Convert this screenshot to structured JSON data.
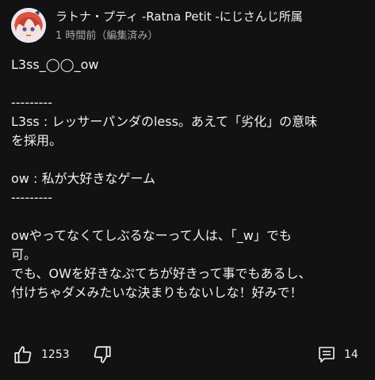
{
  "post": {
    "author": "ラトナ・プティ -Ratna Petit -にじさんじ所属",
    "timestamp": "1 時間前（編集済み）",
    "body_lines": [
      "L3ss_◯◯_ow",
      "",
      "---------",
      "L3ss : レッサーパンダのless。あえて「劣化」の意味",
      "を採用。",
      "",
      "ow : 私が大好きなゲーム",
      "---------",
      "",
      "owやってなくてしぶるなーって人は、「_w」でも",
      "可。",
      "でも、OWを好きなぷてちが好きって事でもあるし、",
      "付けちゃダメみたいな決まりもないしな！好みで！"
    ]
  },
  "actions": {
    "like_icon": "thumbs-up-icon",
    "like_count": "1253",
    "dislike_icon": "thumbs-down-icon",
    "reply_icon": "comment-icon",
    "reply_count": "14"
  }
}
